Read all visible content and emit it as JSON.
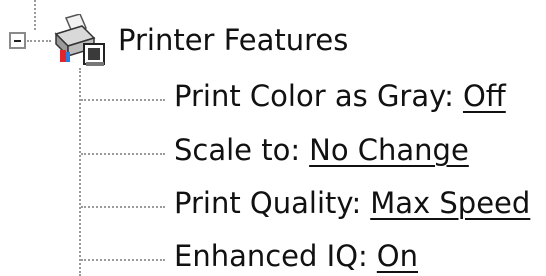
{
  "tree": {
    "root": {
      "label": "Printer Features",
      "expanded": true
    },
    "items": [
      {
        "label": "Print Color as Gray:",
        "value": "Off"
      },
      {
        "label": "Scale to:",
        "value": "No Change"
      },
      {
        "label": "Print Quality:",
        "value": "Max Speed"
      },
      {
        "label": "Enhanced IQ:",
        "value": "On"
      }
    ]
  }
}
